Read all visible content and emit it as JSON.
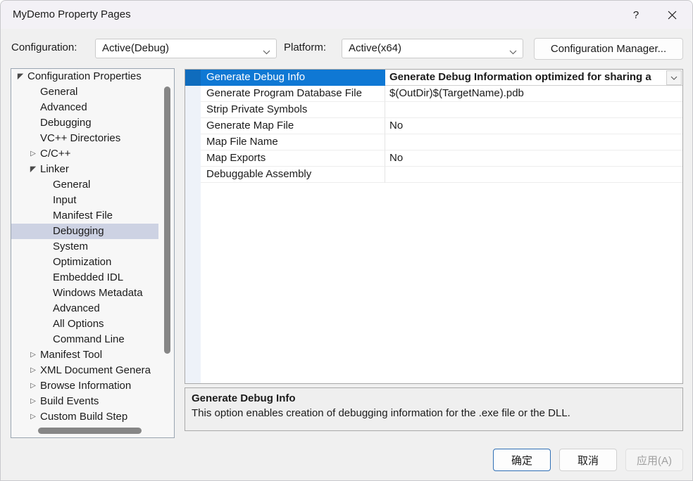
{
  "window": {
    "title": "MyDemo Property Pages",
    "help_icon": "?",
    "close_icon": "close-icon"
  },
  "toolbar": {
    "configuration_label": "Configuration:",
    "configuration_value": "Active(Debug)",
    "platform_label": "Platform:",
    "platform_value": "Active(x64)",
    "configuration_manager_label": "Configuration Manager..."
  },
  "tree": {
    "selected": "Debugging",
    "nodes": [
      {
        "label": "Configuration Properties",
        "depth": 0,
        "twisty": "expanded"
      },
      {
        "label": "General",
        "depth": 1,
        "twisty": "none"
      },
      {
        "label": "Advanced",
        "depth": 1,
        "twisty": "none"
      },
      {
        "label": "Debugging",
        "depth": 1,
        "twisty": "none"
      },
      {
        "label": "VC++ Directories",
        "depth": 1,
        "twisty": "none"
      },
      {
        "label": "C/C++",
        "depth": 1,
        "twisty": "collapsed"
      },
      {
        "label": "Linker",
        "depth": 1,
        "twisty": "expanded"
      },
      {
        "label": "General",
        "depth": 2,
        "twisty": "none"
      },
      {
        "label": "Input",
        "depth": 2,
        "twisty": "none"
      },
      {
        "label": "Manifest File",
        "depth": 2,
        "twisty": "none"
      },
      {
        "label": "Debugging",
        "depth": 2,
        "twisty": "none",
        "selected": true
      },
      {
        "label": "System",
        "depth": 2,
        "twisty": "none"
      },
      {
        "label": "Optimization",
        "depth": 2,
        "twisty": "none"
      },
      {
        "label": "Embedded IDL",
        "depth": 2,
        "twisty": "none"
      },
      {
        "label": "Windows Metadata",
        "depth": 2,
        "twisty": "none"
      },
      {
        "label": "Advanced",
        "depth": 2,
        "twisty": "none"
      },
      {
        "label": "All Options",
        "depth": 2,
        "twisty": "none"
      },
      {
        "label": "Command Line",
        "depth": 2,
        "twisty": "none"
      },
      {
        "label": "Manifest Tool",
        "depth": 1,
        "twisty": "collapsed"
      },
      {
        "label": "XML Document Genera",
        "depth": 1,
        "twisty": "collapsed"
      },
      {
        "label": "Browse Information",
        "depth": 1,
        "twisty": "collapsed"
      },
      {
        "label": "Build Events",
        "depth": 1,
        "twisty": "collapsed"
      },
      {
        "label": "Custom Build Step",
        "depth": 1,
        "twisty": "collapsed"
      }
    ]
  },
  "grid": {
    "rows": [
      {
        "name": "Generate Debug Info",
        "value": "Generate Debug Information optimized for sharing a",
        "selected": true
      },
      {
        "name": "Generate Program Database File",
        "value": "$(OutDir)$(TargetName).pdb",
        "selected": false
      },
      {
        "name": "Strip Private Symbols",
        "value": "",
        "selected": false
      },
      {
        "name": "Generate Map File",
        "value": "No",
        "selected": false
      },
      {
        "name": "Map File Name",
        "value": "",
        "selected": false
      },
      {
        "name": "Map Exports",
        "value": "No",
        "selected": false
      },
      {
        "name": "Debuggable Assembly",
        "value": "",
        "selected": false
      }
    ]
  },
  "description": {
    "title": "Generate Debug Info",
    "body": "This option enables creation of debugging information for the .exe file or the DLL."
  },
  "footer": {
    "ok_label": "确定",
    "cancel_label": "取消",
    "apply_label": "应用(A)"
  },
  "colors": {
    "selection_blue": "#0f78d4",
    "tree_selection": "#cdd2e3",
    "titlebar": "#f3f1f6",
    "default_button_border": "#2f6fb5"
  }
}
